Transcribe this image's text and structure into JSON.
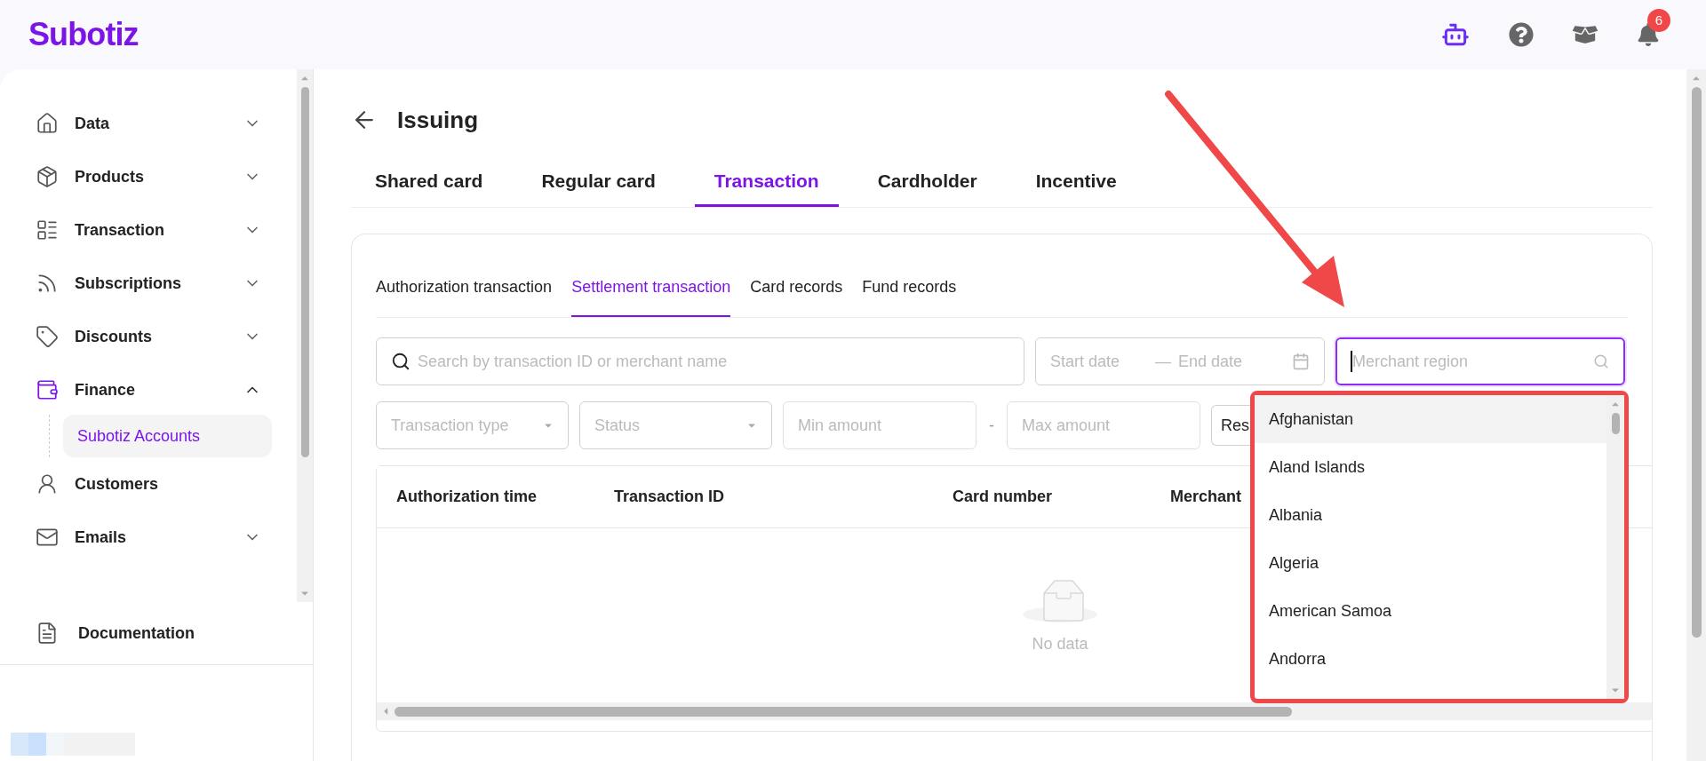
{
  "header": {
    "logo": "Subotiz",
    "notification_count": "6"
  },
  "sidebar": {
    "items": [
      {
        "label": "Data",
        "kind": "group",
        "expanded": false,
        "selected": false
      },
      {
        "label": "Products",
        "kind": "group",
        "expanded": false,
        "selected": false
      },
      {
        "label": "Transaction",
        "kind": "group",
        "expanded": false,
        "selected": false
      },
      {
        "label": "Subscriptions",
        "kind": "group",
        "expanded": false,
        "selected": false
      },
      {
        "label": "Discounts",
        "kind": "group",
        "expanded": false,
        "selected": false
      },
      {
        "label": "Finance",
        "kind": "group",
        "expanded": true,
        "selected": true,
        "children": [
          {
            "label": "Subotiz Accounts",
            "selected": true
          }
        ]
      },
      {
        "label": "Customers",
        "kind": "link",
        "selected": false
      },
      {
        "label": "Emails",
        "kind": "group",
        "expanded": false,
        "selected": false
      }
    ],
    "footer": {
      "label": "Documentation"
    }
  },
  "page": {
    "title": "Issuing",
    "tabs": [
      {
        "label": "Shared card",
        "selected": false
      },
      {
        "label": "Regular card",
        "selected": false
      },
      {
        "label": "Transaction",
        "selected": true
      },
      {
        "label": "Cardholder",
        "selected": false
      },
      {
        "label": "Incentive",
        "selected": false
      }
    ],
    "subtabs": [
      {
        "label": "Authorization transaction",
        "selected": false
      },
      {
        "label": "Settlement transaction",
        "selected": true
      },
      {
        "label": "Card records",
        "selected": false
      },
      {
        "label": "Fund records",
        "selected": false
      }
    ],
    "filters": {
      "search": {
        "placeholder": "Search by transaction ID or merchant name"
      },
      "start_date": {
        "placeholder": "Start date"
      },
      "date_separator": "—",
      "end_date": {
        "placeholder": "End date"
      },
      "region": {
        "placeholder": "Merchant region"
      },
      "transaction_type": {
        "placeholder": "Transaction type"
      },
      "status": {
        "placeholder": "Status"
      },
      "min_amount": {
        "placeholder": "Min amount"
      },
      "amount_separator": "-",
      "max_amount": {
        "placeholder": "Max amount"
      },
      "reset_button": "Res"
    },
    "table": {
      "columns": [
        "Authorization time",
        "Transaction ID",
        "Card number",
        "Merchant"
      ],
      "empty_text": "No data"
    },
    "region_dropdown": {
      "options": [
        {
          "label": "Afghanistan",
          "selected": true
        },
        {
          "label": "Aland Islands",
          "selected": false
        },
        {
          "label": "Albania",
          "selected": false
        },
        {
          "label": "Algeria",
          "selected": false
        },
        {
          "label": "American Samoa",
          "selected": false
        },
        {
          "label": "Andorra",
          "selected": false
        }
      ]
    }
  }
}
